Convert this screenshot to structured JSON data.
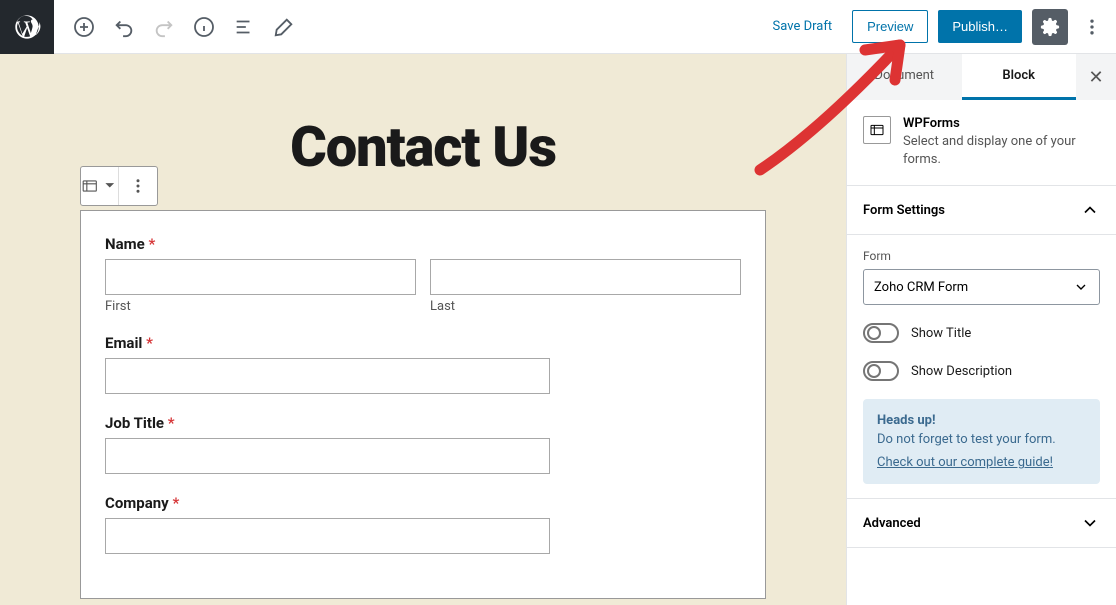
{
  "toolbar": {
    "save_draft": "Save Draft",
    "preview": "Preview",
    "publish": "Publish…"
  },
  "editor": {
    "page_title": "Contact Us",
    "form": {
      "name_label": "Name",
      "first_sublabel": "First",
      "last_sublabel": "Last",
      "email_label": "Email",
      "job_title_label": "Job Title",
      "company_label": "Company"
    }
  },
  "sidebar": {
    "tabs": {
      "document": "Document",
      "block": "Block"
    },
    "block": {
      "name": "WPForms",
      "description": "Select and display one of your forms."
    },
    "form_settings": {
      "title": "Form Settings",
      "form_label": "Form",
      "selected_form": "Zoho CRM Form",
      "show_title": "Show Title",
      "show_description": "Show Description"
    },
    "notice": {
      "heading": "Heads up!",
      "text": "Do not forget to test your form.",
      "link": "Check out our complete guide!"
    },
    "advanced": "Advanced"
  }
}
